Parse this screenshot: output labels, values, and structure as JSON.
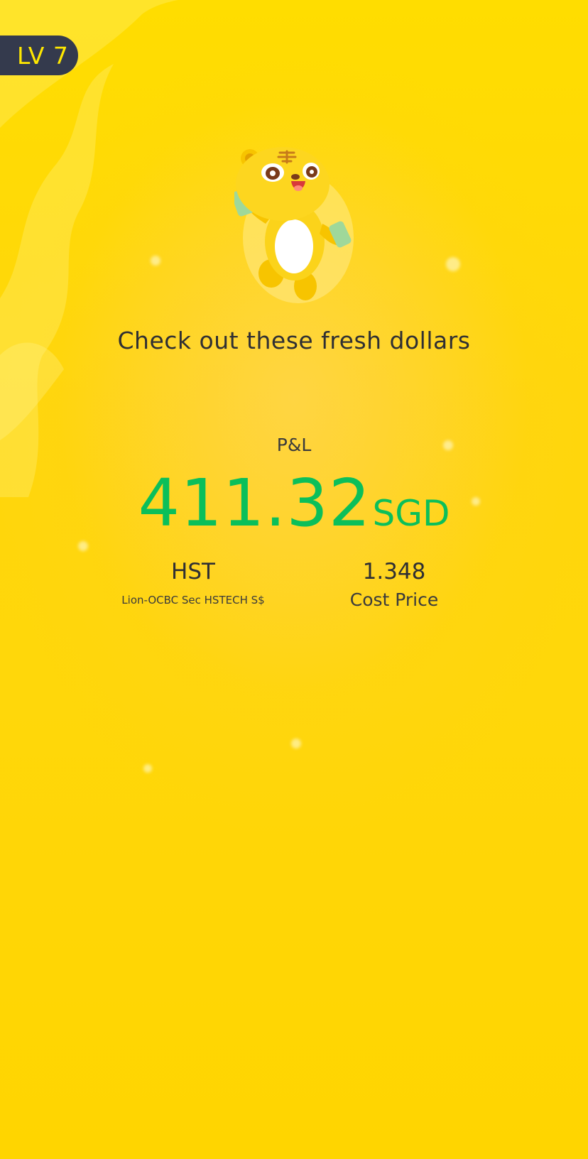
{
  "badge": {
    "level_label": "LV 7"
  },
  "headline": "Check out these fresh dollars",
  "pnl": {
    "label": "P&L",
    "amount": "411.32",
    "currency": "SGD"
  },
  "stock": {
    "symbol": "HST",
    "name": "Lion-OCBC Sec HSTECH S$"
  },
  "cost": {
    "value": "1.348",
    "label": "Cost Price"
  },
  "icons": {
    "mascot": "tiger-mascot-icon"
  },
  "colors": {
    "background": "#ffd800",
    "badge_bg": "#343a4d",
    "badge_text": "#ffe800",
    "profit_green": "#0bbf5a",
    "text_dark": "#2f2f33"
  }
}
